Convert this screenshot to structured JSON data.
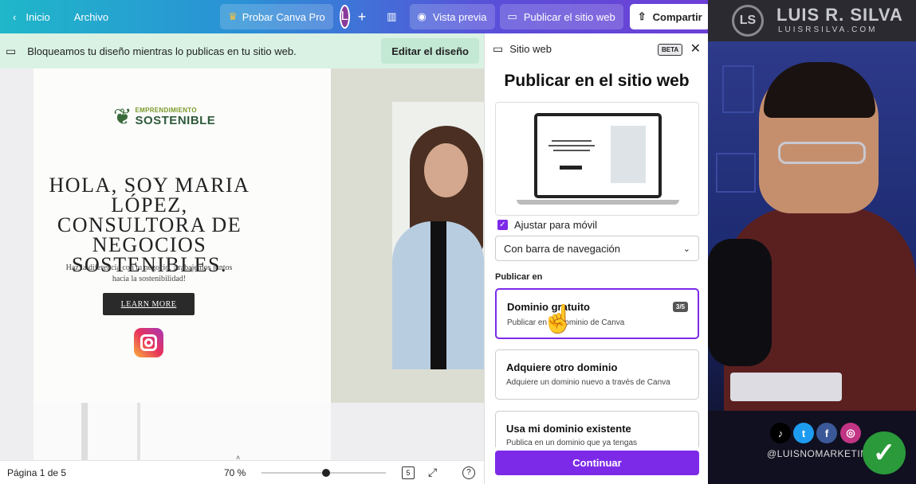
{
  "topbar": {
    "home": "Inicio",
    "file": "Archivo",
    "pro": "Probar Canva Pro",
    "avatar_letter": "L",
    "preview": "Vista previa",
    "publish": "Publicar el sitio web",
    "share": "Compartir"
  },
  "notice": {
    "text": "Bloqueamos tu diseño mientras lo publicas en tu sitio web.",
    "edit": "Editar el diseño"
  },
  "design": {
    "logo_line1": "EMPRENDIMIENTO",
    "logo_line2": "SOSTENIBLE",
    "headline": "HOLA, SOY MARIA LÓPEZ, CONSULTORA DE NEGOCIOS SOSTENIBLES.",
    "subtext": "Haz la diferencia con tu negocio, ¡trabajemos juntos hacia la sostenibilidad!",
    "cta": "LEARN MORE"
  },
  "bottombar": {
    "page": "Página 1 de 5",
    "zoom": "70 %",
    "zoom_level_fraction": 0.52,
    "pages_count": "5"
  },
  "panel": {
    "header": "Sitio web",
    "beta": "BETA",
    "title": "Publicar en el sitio web",
    "mobile_label": "Ajustar para móvil",
    "nav_option": "Con barra de navegación",
    "publish_in": "Publicar en",
    "options": [
      {
        "title": "Dominio gratuito",
        "subtitle": "Publicar en un dominio de Canva",
        "badge": "3/5"
      },
      {
        "title": "Adquiere otro dominio",
        "subtitle": "Adquiere un dominio nuevo a través de Canva"
      },
      {
        "title": "Usa mi dominio existente",
        "subtitle": "Publica en un dominio que ya tengas"
      }
    ],
    "continue": "Continuar"
  },
  "video": {
    "brand": "LUIS R. SILVA",
    "brand_sub": "LUISRSILVA.COM",
    "handle": "@LUISNOMARKETING"
  },
  "colors": {
    "accent": "#7d2ae8",
    "notice_bg": "#d9f2e4"
  }
}
